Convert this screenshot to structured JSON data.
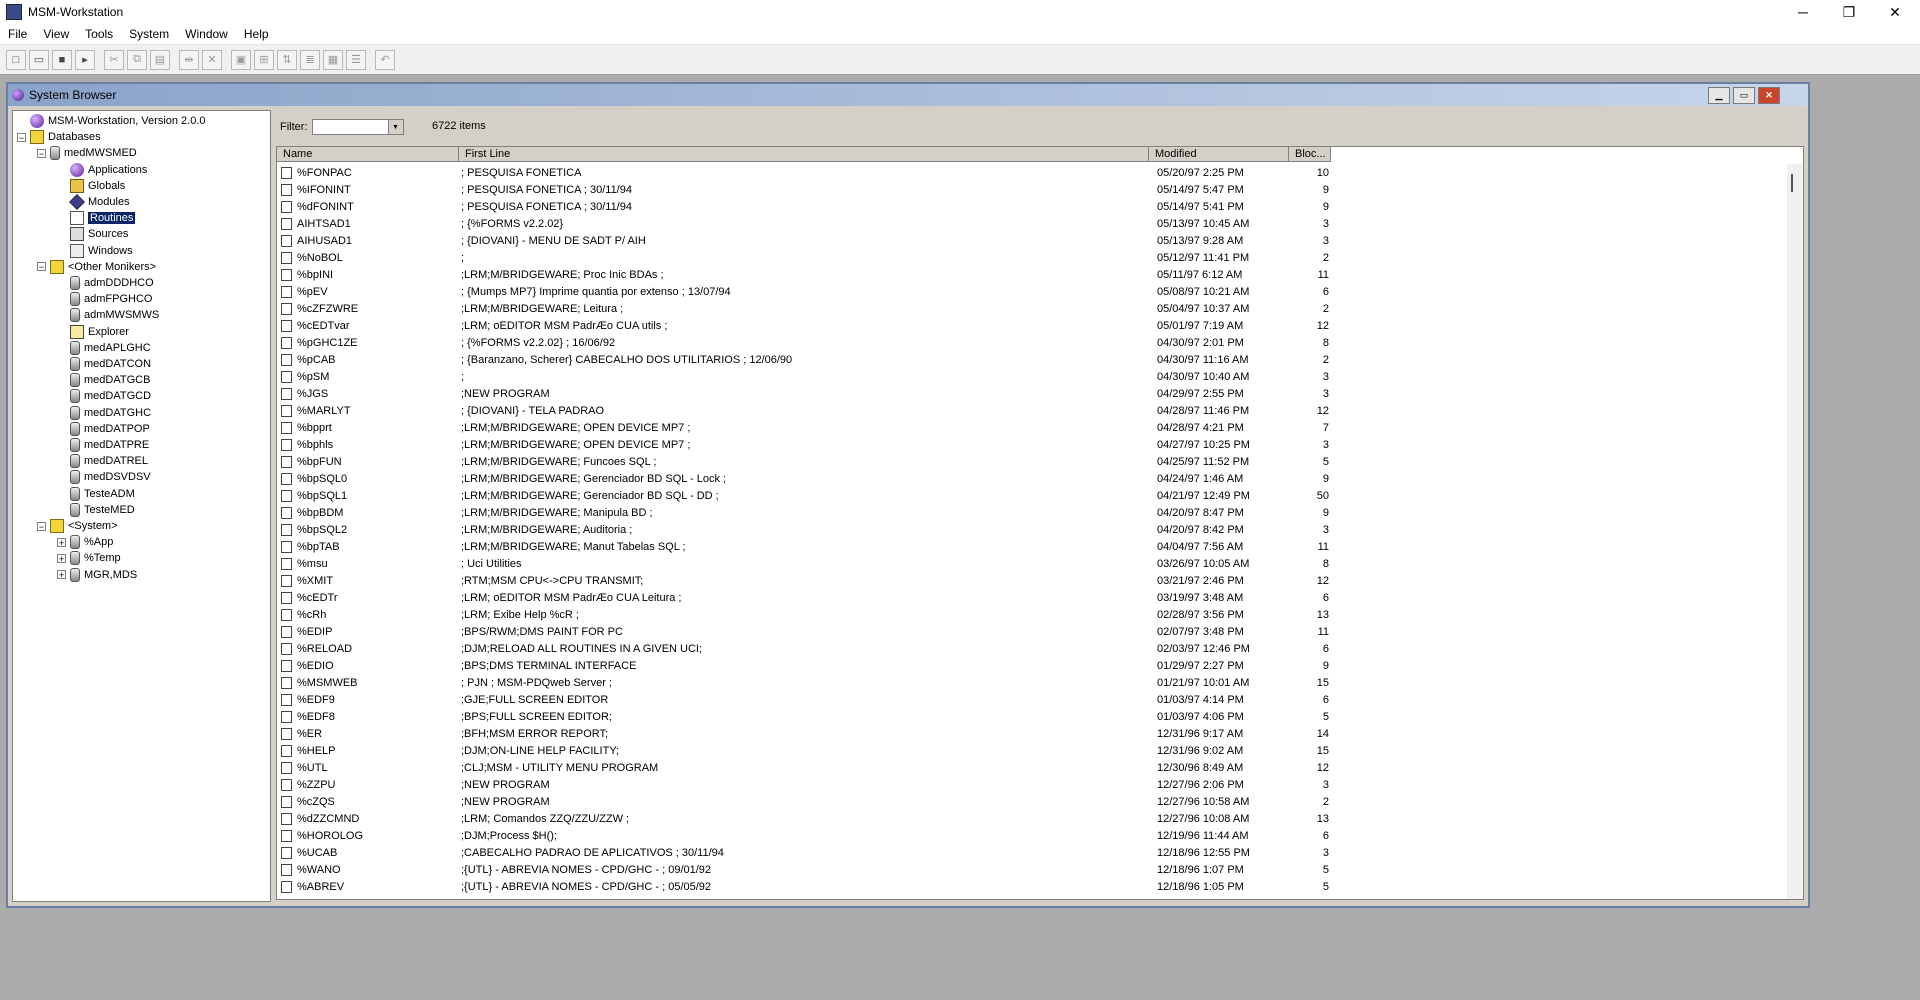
{
  "app": {
    "title": "MSM-Workstation"
  },
  "window_controls": {
    "minimize": "─",
    "maximize": "❐",
    "close": "✕"
  },
  "menu": [
    "File",
    "View",
    "Tools",
    "System",
    "Window",
    "Help"
  ],
  "toolbar": [
    {
      "name": "new-icon",
      "glyph": "□"
    },
    {
      "name": "open-icon",
      "glyph": "▭"
    },
    {
      "name": "save-icon",
      "glyph": "■"
    },
    {
      "name": "run-icon",
      "glyph": "▸"
    },
    {
      "name": "cut-icon",
      "glyph": "✂"
    },
    {
      "name": "copy-icon",
      "glyph": "⧉"
    },
    {
      "name": "paste-icon",
      "glyph": "▤"
    },
    {
      "name": "split-icon",
      "glyph": "⇹"
    },
    {
      "name": "delete-icon",
      "glyph": "✕"
    },
    {
      "name": "properties-icon",
      "glyph": "▣"
    },
    {
      "name": "tree-icon",
      "glyph": "⊞"
    },
    {
      "name": "sort-icon",
      "glyph": "⇅"
    },
    {
      "name": "align-icon",
      "glyph": "≣"
    },
    {
      "name": "table-icon",
      "glyph": "▦"
    },
    {
      "name": "list-icon",
      "glyph": "☰"
    },
    {
      "name": "undo-icon",
      "glyph": "↶"
    }
  ],
  "browser": {
    "title": "System Browser",
    "filter_label": "Filter:",
    "filter_value": "",
    "item_count": "6722 items",
    "columns": [
      "Name",
      "First Line",
      "Modified",
      "Bloc..."
    ]
  },
  "tree": [
    {
      "depth": 0,
      "exp": "",
      "icon": "globe",
      "label": "MSM-Workstation, Version 2.0.0"
    },
    {
      "depth": 0,
      "exp": "−",
      "icon": "cube",
      "label": "Databases"
    },
    {
      "depth": 1,
      "exp": "−",
      "icon": "db",
      "label": "medMWSMED"
    },
    {
      "depth": 2,
      "exp": "",
      "icon": "globe",
      "label": "Applications"
    },
    {
      "depth": 2,
      "exp": "",
      "icon": "glob",
      "label": "Globals"
    },
    {
      "depth": 2,
      "exp": "",
      "icon": "mod",
      "label": "Modules"
    },
    {
      "depth": 2,
      "exp": "",
      "icon": "rout",
      "label": "Routines",
      "selected": true
    },
    {
      "depth": 2,
      "exp": "",
      "icon": "src",
      "label": "Sources"
    },
    {
      "depth": 2,
      "exp": "",
      "icon": "win",
      "label": "Windows"
    },
    {
      "depth": 1,
      "exp": "−",
      "icon": "cube",
      "label": "<Other Monikers>"
    },
    {
      "depth": 2,
      "exp": "",
      "icon": "db",
      "label": "admDDDHCO"
    },
    {
      "depth": 2,
      "exp": "",
      "icon": "db",
      "label": "admFPGHCO"
    },
    {
      "depth": 2,
      "exp": "",
      "icon": "db",
      "label": "admMWSMWS"
    },
    {
      "depth": 2,
      "exp": "",
      "icon": "exp",
      "label": "Explorer"
    },
    {
      "depth": 2,
      "exp": "",
      "icon": "db",
      "label": "medAPLGHC"
    },
    {
      "depth": 2,
      "exp": "",
      "icon": "db",
      "label": "medDATCON"
    },
    {
      "depth": 2,
      "exp": "",
      "icon": "db",
      "label": "medDATGCB"
    },
    {
      "depth": 2,
      "exp": "",
      "icon": "db",
      "label": "medDATGCD"
    },
    {
      "depth": 2,
      "exp": "",
      "icon": "db",
      "label": "medDATGHC"
    },
    {
      "depth": 2,
      "exp": "",
      "icon": "db",
      "label": "medDATPOP"
    },
    {
      "depth": 2,
      "exp": "",
      "icon": "db",
      "label": "medDATPRE"
    },
    {
      "depth": 2,
      "exp": "",
      "icon": "db",
      "label": "medDATREL"
    },
    {
      "depth": 2,
      "exp": "",
      "icon": "db",
      "label": "medDSVDSV"
    },
    {
      "depth": 2,
      "exp": "",
      "icon": "db",
      "label": "TesteADM"
    },
    {
      "depth": 2,
      "exp": "",
      "icon": "db",
      "label": "TesteMED"
    },
    {
      "depth": 1,
      "exp": "−",
      "icon": "cube",
      "label": "<System>"
    },
    {
      "depth": 2,
      "exp": "+",
      "icon": "db",
      "label": "%App"
    },
    {
      "depth": 2,
      "exp": "+",
      "icon": "db",
      "label": "%Temp"
    },
    {
      "depth": 2,
      "exp": "+",
      "icon": "db",
      "label": "MGR,MDS"
    }
  ],
  "routines": [
    [
      "%FONPAC",
      "; PESQUISA FONETICA",
      "05/20/97  2:25 PM",
      "10"
    ],
    [
      "%IFONINT",
      "; PESQUISA FONETICA ; 30/11/94",
      "05/14/97  5:47 PM",
      "9"
    ],
    [
      "%dFONINT",
      "; PESQUISA FONETICA ; 30/11/94",
      "05/14/97  5:41 PM",
      "9"
    ],
    [
      "AIHTSAD1",
      "; {%FORMS v2.2.02}",
      "05/13/97 10:45 AM",
      "3"
    ],
    [
      "AIHUSAD1",
      "; {DIOVANI} - MENU DE SADT P/ AIH",
      "05/13/97  9:28 AM",
      "3"
    ],
    [
      "%NoBOL",
      ";",
      "05/12/97 11:41 PM",
      "2"
    ],
    [
      "%bpINI",
      ";LRM;M/BRIDGEWARE; Proc Inic BDAs ;",
      "05/11/97  6:12 AM",
      "11"
    ],
    [
      "%pEV",
      "; {Mumps MP7} Imprime quantia por extenso ; 13/07/94",
      "05/08/97 10:21 AM",
      "6"
    ],
    [
      "%cZFZWRE",
      ";LRM;M/BRIDGEWARE; Leitura ;",
      "05/04/97 10:37 AM",
      "2"
    ],
    [
      "%cEDTvar",
      ";LRM; oEDITOR MSM PadrÆo CUA  utils ;",
      "05/01/97  7:19 AM",
      "12"
    ],
    [
      "%pGHC1ZE",
      "; {%FORMS v2.2.02} ; 16/06/92",
      "04/30/97  2:01 PM",
      "8"
    ],
    [
      "%pCAB",
      "; {Baranzano, Scherer} CABECALHO DOS UTILITARIOS ; 12/06/90",
      "04/30/97 11:16 AM",
      "2"
    ],
    [
      "%pSM",
      ";",
      "04/30/97 10:40 AM",
      "3"
    ],
    [
      "%JGS",
      ";NEW PROGRAM",
      "04/29/97  2:55 PM",
      "3"
    ],
    [
      "%MARLYT",
      "; {DIOVANI} - TELA PADRAO",
      "04/28/97 11:46 PM",
      "12"
    ],
    [
      "%bpprt",
      ";LRM;M/BRIDGEWARE; OPEN DEVICE MP7 ;",
      "04/28/97  4:21 PM",
      "7"
    ],
    [
      "%bphls",
      ";LRM;M/BRIDGEWARE; OPEN DEVICE MP7 ;",
      "04/27/97 10:25 PM",
      "3"
    ],
    [
      "%bpFUN",
      ";LRM;M/BRIDGEWARE; Funcoes SQL ;",
      "04/25/97 11:52 PM",
      "5"
    ],
    [
      "%bpSQL0",
      ";LRM;M/BRIDGEWARE; Gerenciador BD SQL - Lock ;",
      "04/24/97  1:46 AM",
      "9"
    ],
    [
      "%bpSQL1",
      ";LRM;M/BRIDGEWARE; Gerenciador BD SQL - DD ;",
      "04/21/97 12:49 PM",
      "50"
    ],
    [
      "%bpBDM",
      ";LRM;M/BRIDGEWARE; Manipula BD ;",
      "04/20/97  8:47 PM",
      "9"
    ],
    [
      "%bpSQL2",
      ";LRM;M/BRIDGEWARE; Auditoria ;",
      "04/20/97  8:42 PM",
      "3"
    ],
    [
      "%bpTAB",
      ";LRM;M/BRIDGEWARE; Manut Tabelas SQL ;",
      "04/04/97  7:56 AM",
      "11"
    ],
    [
      "%msu",
      "; Uci Utilities",
      "03/26/97 10:05 AM",
      "8"
    ],
    [
      "%XMIT",
      ";RTM;MSM CPU<->CPU TRANSMIT;",
      "03/21/97  2:46 PM",
      "12"
    ],
    [
      "%cEDTr",
      ";LRM; oEDITOR MSM PadrÆo CUA  Leitura ;",
      "03/19/97  3:48 AM",
      "6"
    ],
    [
      "%cRh",
      ";LRM; Exibe Help %cR ;",
      "02/28/97  3:56 PM",
      "13"
    ],
    [
      "%EDIP",
      ";BPS/RWM;DMS PAINT FOR PC",
      "02/07/97  3:48 PM",
      "11"
    ],
    [
      "%RELOAD",
      ";DJM;RELOAD ALL ROUTINES IN A GIVEN UCI;",
      "02/03/97 12:46 PM",
      "6"
    ],
    [
      "%EDIO",
      ";BPS;DMS TERMINAL INTERFACE",
      "01/29/97  2:27 PM",
      "9"
    ],
    [
      "%MSMWEB",
      "; PJN ; MSM-PDQweb Server ;",
      "01/21/97 10:01 AM",
      "15"
    ],
    [
      "%EDF9",
      ";GJE;FULL SCREEN EDITOR",
      "01/03/97  4:14 PM",
      "6"
    ],
    [
      "%EDF8",
      ";BPS;FULL SCREEN EDITOR;",
      "01/03/97  4:06 PM",
      "5"
    ],
    [
      "%ER",
      ";BFH;MSM ERROR REPORT;",
      "12/31/96  9:17 AM",
      "14"
    ],
    [
      "%HELP",
      ";DJM;ON-LINE HELP FACILITY;",
      "12/31/96  9:02 AM",
      "15"
    ],
    [
      "%UTL",
      ";CLJ;MSM - UTILITY MENU PROGRAM",
      "12/30/96  8:49 AM",
      "12"
    ],
    [
      "%ZZPU",
      ";NEW PROGRAM",
      "12/27/96  2:06 PM",
      "3"
    ],
    [
      "%cZQS",
      ";NEW PROGRAM",
      "12/27/96 10:58 AM",
      "2"
    ],
    [
      "%dZZCMND",
      ";LRM; Comandos ZZQ/ZZU/ZZW ;",
      "12/27/96 10:08 AM",
      "13"
    ],
    [
      "%HOROLOG",
      ";DJM;Process $H();",
      "12/19/96 11:44 AM",
      "6"
    ],
    [
      "%UCAB",
      ";CABECALHO PADRAO DE APLICATIVOS ; 30/11/94",
      "12/18/96 12:55 PM",
      "3"
    ],
    [
      "%WANO",
      ";{UTL} - ABREVIA NOMES - CPD/GHC - ; 09/01/92",
      "12/18/96  1:07 PM",
      "5"
    ],
    [
      "%ABREV",
      ";{UTL} - ABREVIA NOMES - CPD/GHC - ; 05/05/92",
      "12/18/96  1:05 PM",
      "5"
    ]
  ]
}
